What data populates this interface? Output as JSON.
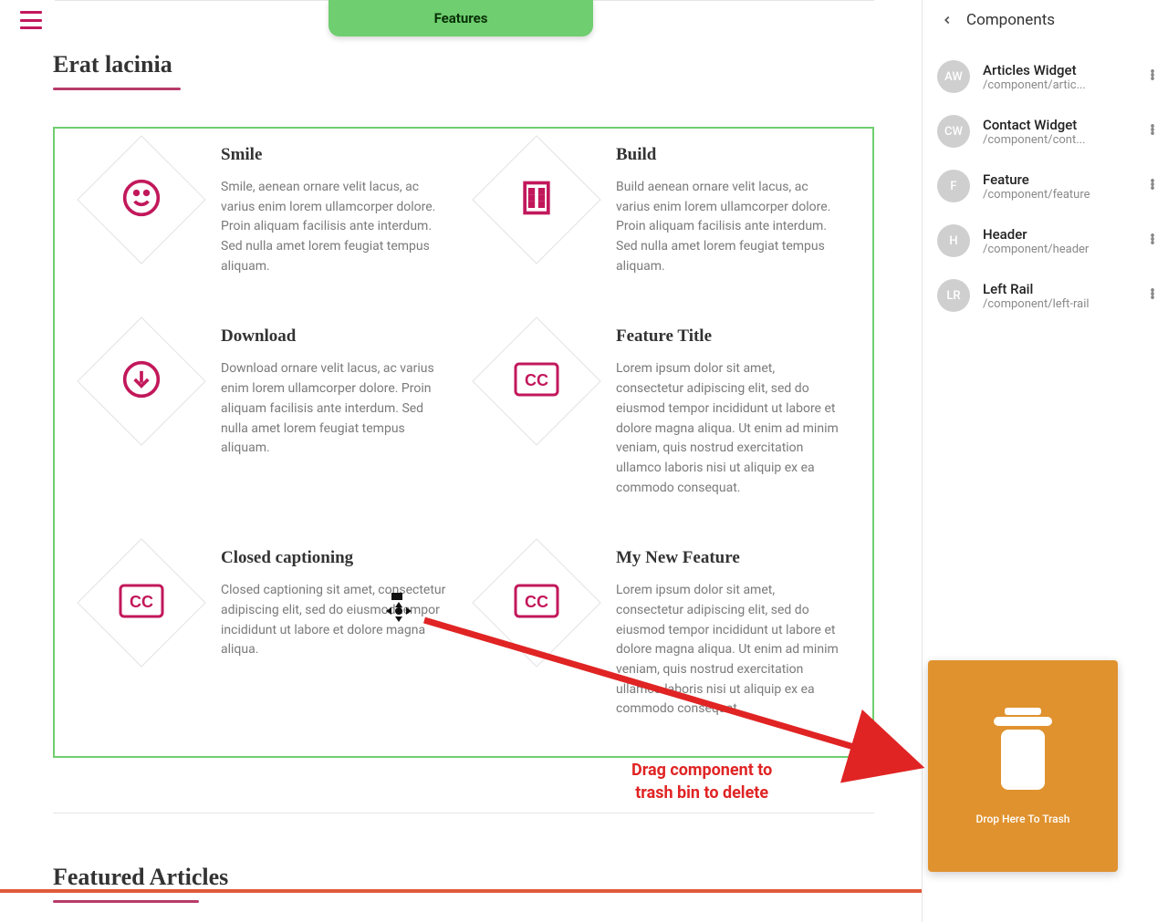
{
  "topbar": {
    "pill_label": "Features"
  },
  "section1": {
    "title": "Erat lacinia"
  },
  "features": [
    {
      "title": "Smile",
      "desc": "Smile, aenean ornare velit lacus, ac varius enim lorem ullamcorper dolore. Proin aliquam facilisis ante interdum. Sed nulla amet lorem feugiat tempus aliquam.",
      "icon": "smile"
    },
    {
      "title": "Build",
      "desc": "Build aenean ornare velit lacus, ac varius enim lorem ullamcorper dolore. Proin aliquam facilisis ante interdum. Sed nulla amet lorem feugiat tempus aliquam.",
      "icon": "building"
    },
    {
      "title": "Download",
      "desc": "Download ornare velit lacus, ac varius enim lorem ullamcorper dolore. Proin aliquam facilisis ante interdum. Sed nulla amet lorem feugiat tempus aliquam.",
      "icon": "download"
    },
    {
      "title": "Feature Title",
      "desc": "Lorem ipsum dolor sit amet, consectetur adipiscing elit, sed do eiusmod tempor incididunt ut labore et dolore magna aliqua. Ut enim ad minim veniam, quis nostrud exercitation ullamco laboris nisi ut aliquip ex ea commodo consequat.",
      "icon": "cc"
    },
    {
      "title": "Closed captioning",
      "desc": "Closed captioning sit amet, consectetur adipiscing elit, sed do eiusmod tempor incididunt ut labore et dolore magna aliqua.",
      "icon": "cc"
    },
    {
      "title": "My New Feature",
      "desc": "Lorem ipsum dolor sit amet, consectetur adipiscing elit, sed do eiusmod tempor incididunt ut labore et dolore magna aliqua. Ut enim ad minim veniam, quis nostrud exercitation ullamco laboris nisi ut aliquip ex ea commodo consequat.",
      "icon": "cc"
    }
  ],
  "section2": {
    "title": "Featured Articles"
  },
  "annotation": {
    "text": "Drag component to\ntrash bin to delete"
  },
  "sidebar": {
    "title": "Components",
    "items": [
      {
        "initials": "AW",
        "name": "Articles Widget",
        "path": "/component/artic..."
      },
      {
        "initials": "CW",
        "name": "Contact Widget",
        "path": "/component/cont..."
      },
      {
        "initials": "F",
        "name": "Feature",
        "path": "/component/feature"
      },
      {
        "initials": "H",
        "name": "Header",
        "path": "/component/header"
      },
      {
        "initials": "LR",
        "name": "Left Rail",
        "path": "/component/left-rail"
      }
    ]
  },
  "trash": {
    "label": "Drop Here To Trash"
  }
}
